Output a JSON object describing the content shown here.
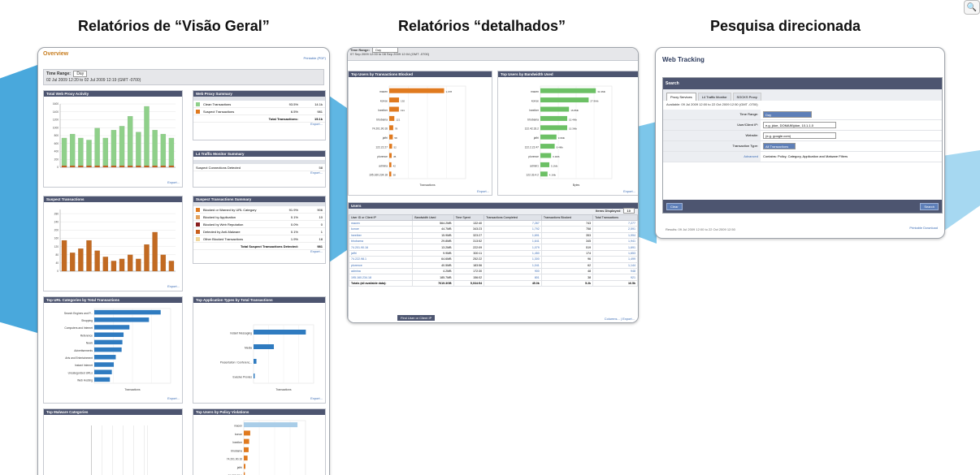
{
  "headings": {
    "overview": "Relatórios de “Visão Geral”",
    "detailed": "Relatórios “detalhados”",
    "search": "Pesquisa direcionada"
  },
  "overview": {
    "title": "Overview",
    "printable": "Printable (PDF)",
    "time_range_label": "Time Range:",
    "time_range_value": "Day",
    "date_range": "02 Jul 2009 12:20 to 02 Jul 2009 12:19 (GMT -0700)",
    "sections": {
      "web_proxy_activity": "Total Web Proxy Activity",
      "web_proxy_summary": "Web Proxy Summary",
      "l4tm_summary": "L4 Traffic Monitor Summary",
      "suspect_transactions": "Suspect Transactions",
      "suspect_summary": "Suspect Transactions Summary",
      "top_url_categories": "Top URL Categories by Total Transactions",
      "top_app_types": "Top Application Types by Total Transactions",
      "top_malware": "Top Malware Categories",
      "top_users_policy": "Top Users by Policy Violations"
    },
    "proxy_summary": {
      "rows": [
        {
          "label": "Clean Transactions",
          "pct": "93.5%",
          "value": "14.1k"
        },
        {
          "label": "Suspect Transactions",
          "pct": "6.5%",
          "value": "981"
        }
      ],
      "total_label": "Total Transactions:",
      "total_value": "15.1k"
    },
    "l4tm": {
      "row_label": "Suspect Connections Detected",
      "value": "58"
    },
    "suspect_rows": [
      {
        "label": "Blocked or Warned by URL Category",
        "pct": "91.9%",
        "value": "906"
      },
      {
        "label": "Blocked by Application",
        "pct": "0.1%",
        "value": "10"
      },
      {
        "label": "Blocked by Web Reputation",
        "pct": "0.0%",
        "value": "0"
      },
      {
        "label": "Detected by Anti-Malware",
        "pct": "0.1%",
        "value": "1"
      },
      {
        "label": "Other Blocked Transactions",
        "pct": "1.9%",
        "value": "18"
      }
    ],
    "suspect_total_label": "Total Suspect Transactions Detected:",
    "suspect_total_value": "981",
    "export": "Export...",
    "url_categories": [
      "Search Engines and P...",
      "Shopping",
      "Computers and Internet",
      "Reference",
      "News",
      "Advertisements",
      "Arts and Entertainment",
      "Instant Internet",
      "Uncategorized URLs",
      "Web Hosting"
    ],
    "app_types": [
      "Instant Messaging",
      "Media",
      "Presentation / Conferenc...",
      "Evasive Proxies"
    ],
    "policy_users": [
      "macen",
      "konoe",
      "lneeiber",
      "bhobama",
      "74.201.90.16",
      "jaffri",
      "74.222.98.1",
      "plorence"
    ],
    "transactions_label": "Transactions"
  },
  "detailed": {
    "time_range_label": "Time Range:",
    "time_range_value": "Day",
    "date_range": "07 Sep 2009 12:00 to 08 Sep 2009 12:04 (GMT -0700)",
    "chart1_title": "Top Users by Transactions Blocked",
    "chart2_title": "Top Users by Bandwidth Used",
    "chart1_xlabel": "Transactions",
    "chart2_xlabel": "Bytes",
    "users_section": "Users",
    "items_displayed": "Items Displayed",
    "items_value": "10",
    "columns": [
      "User ID or Client IP",
      "Bandwidth Used",
      "Time Spent",
      "Transactions Completed",
      "Transactions Blocked",
      "Total Transactions"
    ],
    "rows": [
      [
        "macen",
        "564.2MB",
        "132:40",
        "7,267",
        "743",
        "7,277"
      ],
      [
        "konoe",
        "44.7MB",
        "343:23",
        "1,792",
        "758",
        "2,591"
      ],
      [
        "lneeiber",
        "15.9MB",
        "323:27",
        "1,691",
        "353",
        "1,994"
      ],
      [
        "bhobama",
        "29.8MB",
        "313:52",
        "1,641",
        "345",
        "1,941"
      ],
      [
        "74.201.90.16",
        "13.2MB",
        "222:09",
        "1,079",
        "519",
        "1,691"
      ],
      [
        "jaffri",
        "9.9MB",
        "300:11",
        "1,450",
        "174",
        "1,653"
      ],
      [
        "74.222.98.1",
        "64.6MB",
        "252:22",
        "1,300",
        "96",
        "1,499"
      ],
      [
        "plorence",
        "40.5MB",
        "183:56",
        "1,041",
        "62",
        "1,144"
      ],
      [
        "admina",
        "4.2MB",
        "172:30",
        "900",
        "48",
        "948"
      ],
      [
        "195.160.234.18",
        "185.7MB",
        "156:02",
        "801",
        "38",
        "921"
      ]
    ],
    "totals": [
      "Totals (all available data):",
      "7619.3GB",
      "5,034:54",
      "45.0k",
      "5.2k",
      "16.5k"
    ],
    "find_button": "Find User or Client IP",
    "columns_link": "Columns... | Export..."
  },
  "search": {
    "title": "Web Tracking",
    "search_bar": "Search",
    "tabs": [
      "Proxy Services",
      "L4 Traffic Monitor",
      "SOCKS Proxy"
    ],
    "instruction": "Available: 09 Jul 2009 12:00 to 22 Oct 2009 12:50 (GMT -0700)",
    "fields": [
      {
        "label": "Time Range:",
        "value": "Day"
      },
      {
        "label": "User/Client IP:",
        "value": "e.g. jdoe, DOMAIN\\jdoe, 10.1.1.0"
      },
      {
        "label": "Website:",
        "value": "(e.g. google.com)"
      },
      {
        "label": "Transaction Type:",
        "value": "All Transactions"
      },
      {
        "label": "Advanced",
        "value": "Contains: Policy, Category, Application and Malware Filters"
      }
    ],
    "clear_button": "Clear",
    "search_button": "Search",
    "footer_left": "Results: 09 Jul 2009 12:00 to 22 Oct 2009 12:50",
    "footer_right": "Printable Download"
  },
  "chart_data": [
    {
      "type": "bar",
      "title": "Total Web Proxy Activity",
      "series": [
        {
          "name": "Clean Transactions",
          "color": "#8fd08a",
          "values": [
            700,
            800,
            700,
            650,
            950,
            700,
            900,
            1000,
            1250,
            850,
            1500,
            900,
            800,
            700
          ]
        },
        {
          "name": "Suspect Transactions",
          "color": "#c95f1d",
          "values": [
            40,
            40,
            40,
            40,
            40,
            40,
            40,
            40,
            40,
            40,
            40,
            40,
            40,
            40
          ]
        }
      ],
      "ylim": [
        0,
        1600
      ],
      "ytick_step": 200
    },
    {
      "type": "bar",
      "title": "Suspect Transactions",
      "series": [
        {
          "name": "Suspect Transactions",
          "color": "#c26a22",
          "values": [
            150,
            90,
            110,
            150,
            100,
            70,
            50,
            60,
            80,
            60,
            130,
            190,
            80,
            50
          ]
        }
      ],
      "ylim": [
        0,
        300
      ],
      "ytick_step": 20
    },
    {
      "type": "bar",
      "orientation": "horizontal",
      "title": "Top URL Categories by Total Transactions",
      "categories": [
        "Search Engines and P...",
        "Shopping",
        "Computers and Internet",
        "Reference",
        "News",
        "Advertisements",
        "Arts and Entertainment",
        "Instant Internet",
        "Uncategorized URLs",
        "Web Hosting"
      ],
      "values": [
        170,
        140,
        90,
        75,
        72,
        70,
        55,
        50,
        45,
        40
      ],
      "color": "#2f7bc0"
    },
    {
      "type": "bar",
      "orientation": "horizontal",
      "title": "Top Application Types by Total Transactions",
      "categories": [
        "Instant Messaging",
        "Media",
        "Presentation / Conferenc...",
        "Evasive Proxies"
      ],
      "values": [
        90,
        35,
        5,
        2
      ],
      "color": "#2f7bc0"
    },
    {
      "type": "bar",
      "orientation": "horizontal",
      "title": "Top Users by Policy Violations",
      "categories": [
        "macen",
        "konoe",
        "lneeiber",
        "bhobama",
        "74.201.90.16",
        "jaffri",
        "74.222.98.1",
        "plorence"
      ],
      "values": [
        100,
        12,
        10,
        9,
        7,
        3,
        2,
        1
      ],
      "colors": [
        "#a9cde8",
        "#e07a1f",
        "#e07a1f",
        "#e07a1f",
        "#e07a1f",
        "#e07a1f",
        "#e07a1f",
        "#e07a1f"
      ]
    },
    {
      "type": "bar",
      "orientation": "horizontal",
      "title": "Top Users by Transactions Blocked",
      "categories": [
        "macen",
        "konoe",
        "lneeiber",
        "bhobama",
        "74.201.90.16",
        "jaffri",
        "122.22.27",
        "plorence",
        "admina",
        "195.160.234.18"
      ],
      "values": [
        1078,
        192,
        190,
        100,
        78,
        70,
        56,
        48,
        42,
        40
      ],
      "labels": [
        "1,078",
        "192",
        "191",
        "121",
        "78",
        "58",
        "52",
        "45",
        "42",
        "38"
      ],
      "color": "#e07a1f",
      "xlim": [
        0,
        1500
      ]
    },
    {
      "type": "bar",
      "orientation": "horizontal",
      "title": "Top Users by Bandwidth Used",
      "categories": [
        "macen",
        "konoe",
        "lneeiber",
        "bhobama",
        "122.42.33.2",
        "jaffri",
        "122.2.22.47",
        "plorence",
        "admin1",
        "122.33.4.2"
      ],
      "values": [
        31,
        27,
        16,
        15,
        15,
        9,
        8,
        6,
        5,
        4
      ],
      "labels": [
        "31.9Mb",
        "27.9Mb",
        "16.8Mb",
        "15.4Mb",
        "15.3Mb",
        "9.9Mb",
        "8.4Mb",
        "6.3Mb",
        "5.1Mb",
        "4.1Mb"
      ],
      "color": "#6cc065",
      "xlim": [
        0,
        40
      ]
    }
  ]
}
